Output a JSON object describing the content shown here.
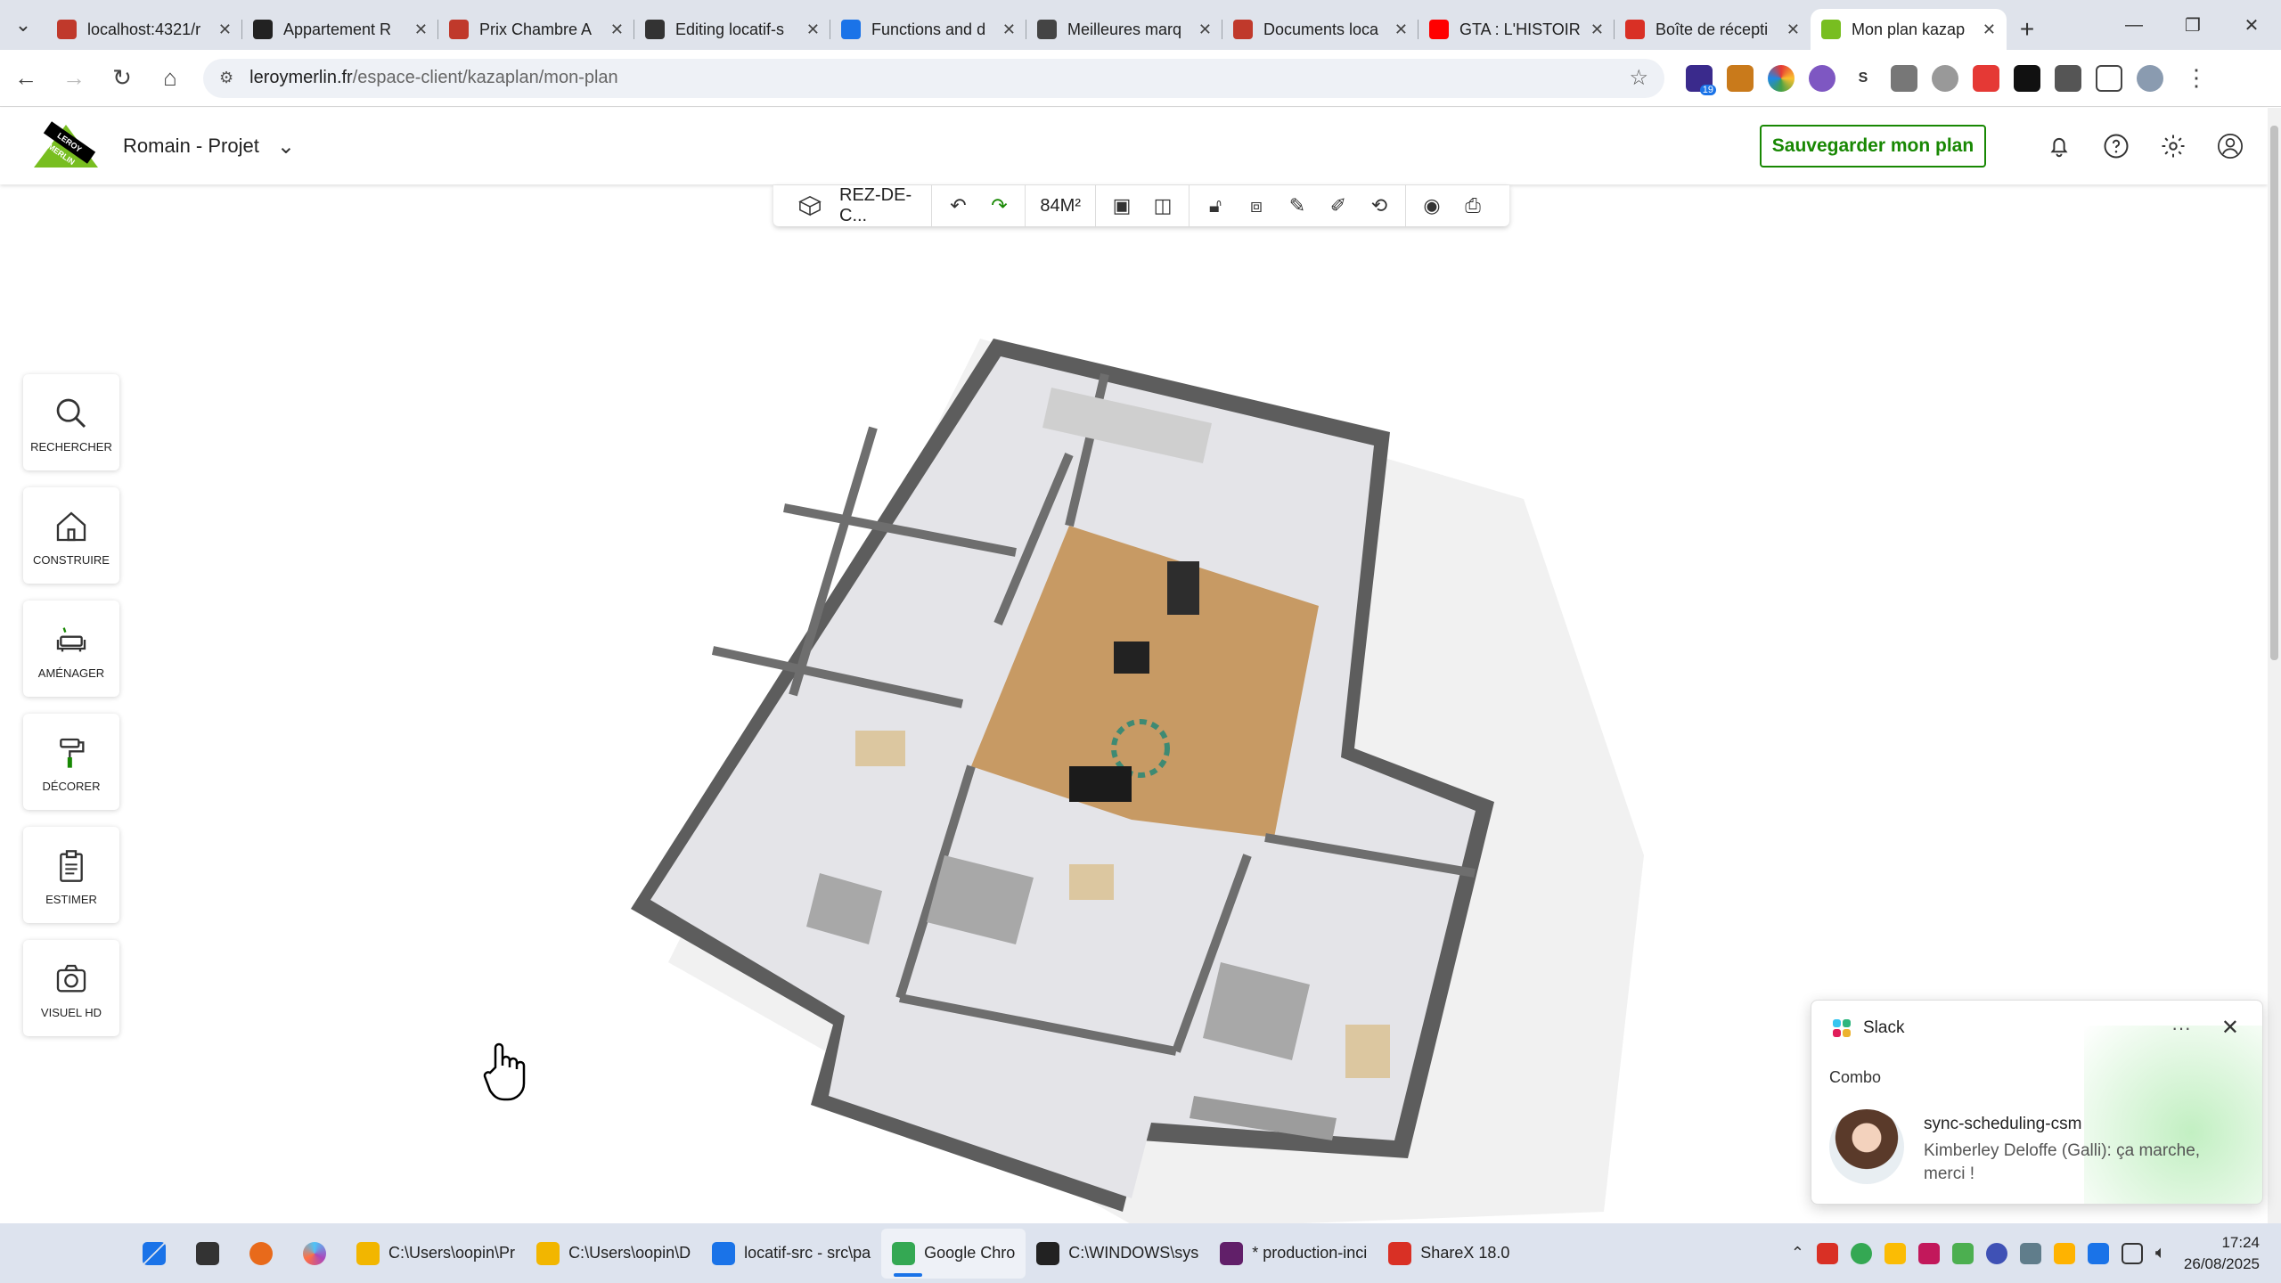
{
  "browser": {
    "tabs": [
      {
        "title": "localhost:4321/r",
        "color": "#c0392b"
      },
      {
        "title": "Appartement R",
        "color": "#222222"
      },
      {
        "title": "Prix Chambre A",
        "color": "#c0392b"
      },
      {
        "title": "Editing locatif-s",
        "color": "#333333"
      },
      {
        "title": "Functions and d",
        "color": "#1a73e8"
      },
      {
        "title": "Meilleures marq",
        "color": "#444444"
      },
      {
        "title": "Documents loca",
        "color": "#c0392b"
      },
      {
        "title": "GTA : L'HISTOIR",
        "color": "#ff0000"
      },
      {
        "title": "Boîte de récepti",
        "color": "#d93025"
      },
      {
        "title": "Mon plan kazap",
        "color": "#78be20"
      }
    ],
    "active_tab_index": 9,
    "url_domain": "leroymerlin.fr",
    "url_path": "/espace-client/kazaplan/mon-plan",
    "extension_badge": "19"
  },
  "header": {
    "logo_text": "LEROY MERLIN",
    "project_name": "Romain - Projet",
    "save_label": "Sauvegarder mon plan"
  },
  "floorbar": {
    "level_label": "REZ-DE-C...",
    "area_label": "84M²"
  },
  "leftmenu": [
    {
      "label": "RECHERCHER",
      "icon": "search-icon"
    },
    {
      "label": "CONSTRUIRE",
      "icon": "house-icon"
    },
    {
      "label": "AMÉNAGER",
      "icon": "sofa-icon"
    },
    {
      "label": "DÉCORER",
      "icon": "paint-roller-icon"
    },
    {
      "label": "ESTIMER",
      "icon": "clipboard-icon"
    },
    {
      "label": "VISUEL HD",
      "icon": "camera-icon"
    }
  ],
  "notification": {
    "app": "Slack",
    "workspace": "Combo",
    "channel": "sync-scheduling-csm",
    "message": "Kimberley Deloffe (Galli): ça marche, merci !"
  },
  "taskbar": {
    "items": [
      {
        "label": "C:\\Users\\oopin\\Pr",
        "color": "#f2b600"
      },
      {
        "label": "C:\\Users\\oopin\\D",
        "color": "#f2b600"
      },
      {
        "label": "locatif-src - src\\pa",
        "color": "#1a73e8"
      },
      {
        "label": "Google Chro",
        "color": "#34a853"
      },
      {
        "label": "C:\\WINDOWS\\sys",
        "color": "#222222"
      },
      {
        "label": "* production-inci",
        "color": "#611f69"
      },
      {
        "label": "ShareX 18.0",
        "color": "#d93025"
      }
    ],
    "active_index": 3,
    "time": "17:24",
    "date": "26/08/2025"
  }
}
